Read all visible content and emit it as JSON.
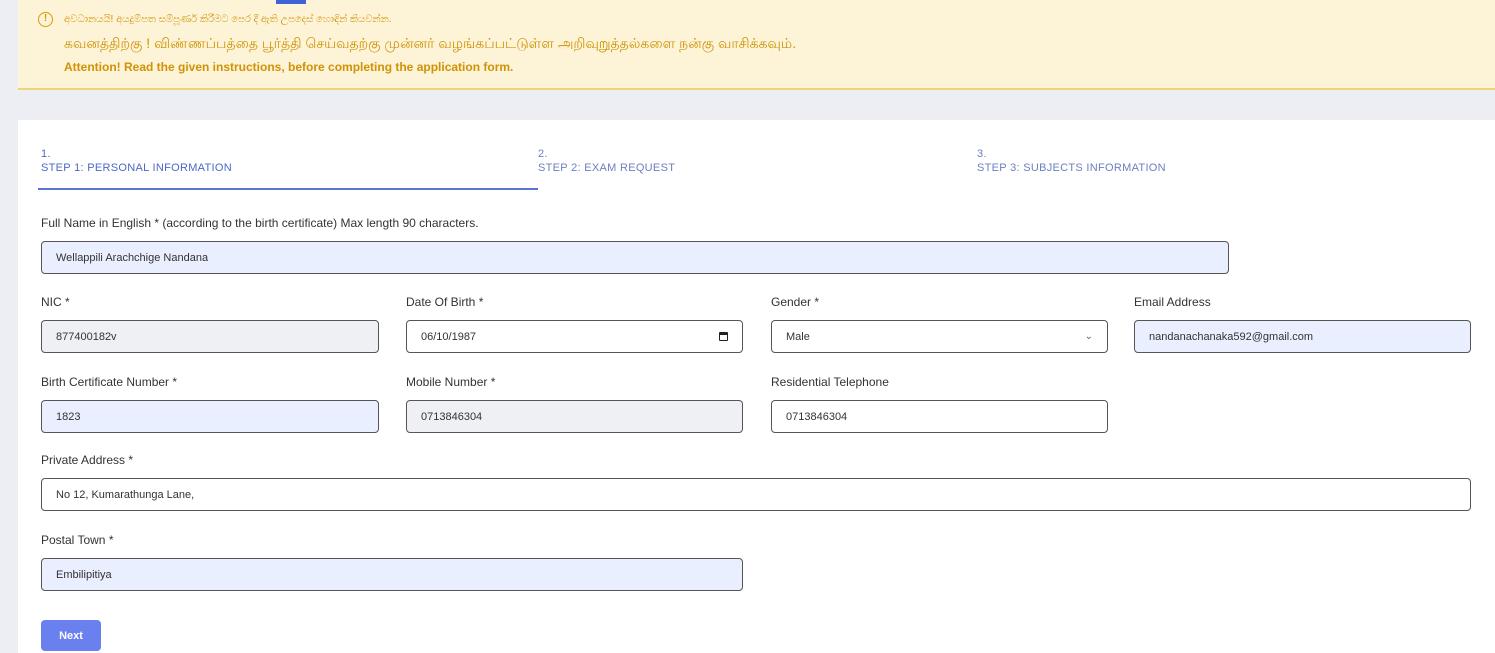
{
  "banner": {
    "sinhala": "අවධානයයි! අයදුම්පත සම්පූර්ණ කිරීමට පෙර දී ඇති උපදෙස් හොඳින් කියවන්න.",
    "tamil": "கவனத்திற்கு ! விண்ணப்பத்தை பூர்த்தி செய்வதற்கு முன்னர் வழங்கப்பட்டுள்ள அறிவுறுத்தல்களை நன்கு வாசிக்கவும்.",
    "english": "Attention! Read the given instructions, before completing the application form."
  },
  "steps": [
    {
      "num": "1.",
      "label": "STEP 1: PERSONAL INFORMATION"
    },
    {
      "num": "2.",
      "label": "STEP 2: EXAM REQUEST"
    },
    {
      "num": "3.",
      "label": "STEP 3: SUBJECTS INFORMATION"
    }
  ],
  "form": {
    "full_name": {
      "label": "Full Name in English * (according to the birth certificate) Max length 90 characters.",
      "value": "Wellappili Arachchige Nandana"
    },
    "nic": {
      "label": "NIC *",
      "value": "877400182v"
    },
    "dob": {
      "label": "Date Of Birth *",
      "value": "06/10/1987"
    },
    "gender": {
      "label": "Gender *",
      "value": "Male"
    },
    "email": {
      "label": "Email Address",
      "value": "nandanachanaka592@gmail.com"
    },
    "birth_cert": {
      "label": "Birth Certificate Number *",
      "value": "1823"
    },
    "mobile": {
      "label": "Mobile Number *",
      "value": "0713846304"
    },
    "res_tel": {
      "label": "Residential Telephone",
      "value": "0713846304"
    },
    "address": {
      "label": "Private Address *",
      "value": "No 12, Kumarathunga Lane,"
    },
    "postal_town": {
      "label": "Postal Town *",
      "value": "Embilipitiya"
    }
  },
  "buttons": {
    "next": "Next"
  },
  "colors": {
    "accent": "#6a80ee",
    "banner_bg": "#fdf3d7",
    "banner_text": "#cf9305",
    "field_bg": "#e9efff"
  },
  "icons": {
    "alert": "exclamation-circle-icon",
    "calendar": "calendar-icon",
    "dropdown": "chevron-down-icon"
  }
}
